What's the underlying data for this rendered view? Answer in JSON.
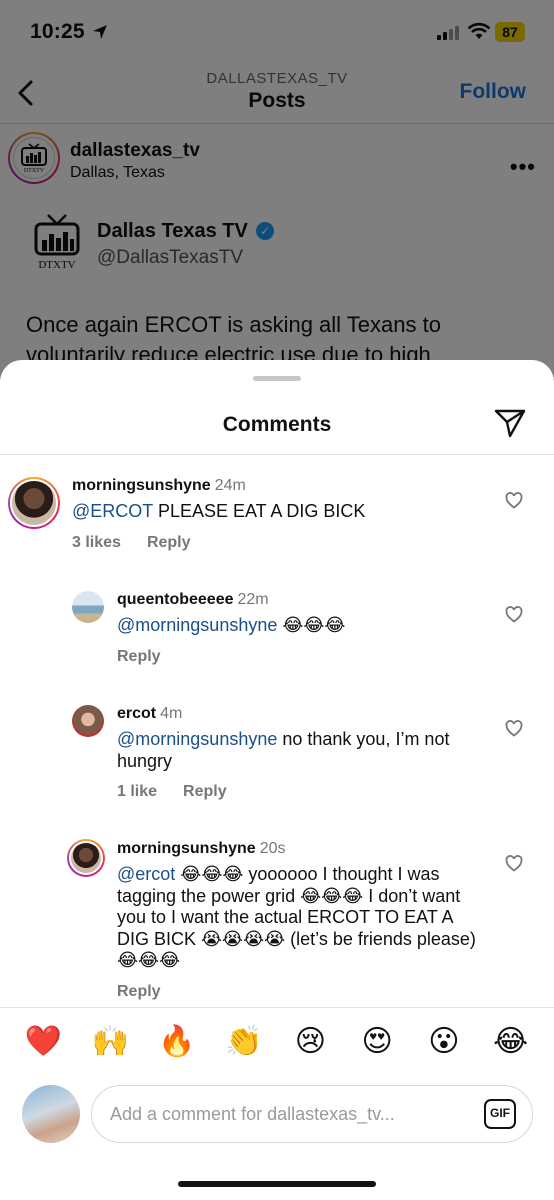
{
  "status_bar": {
    "time": "10:25",
    "battery": "87"
  },
  "nav": {
    "subtitle": "DALLASTEXAS_TV",
    "title": "Posts",
    "follow": "Follow"
  },
  "post": {
    "account": "dallastexas_tv",
    "location": "Dallas, Texas",
    "more": "•••",
    "tweet_name": "Dallas Texas TV",
    "tweet_handle": "@DallasTexasTV",
    "tweet_text": "Once again ERCOT is asking all Texans to voluntarily reduce electric use due to high"
  },
  "sheet": {
    "title": "Comments"
  },
  "comments": [
    {
      "username": "morningsunshyne",
      "ago": "24m",
      "mention": "@ERCOT",
      "text": " PLEASE EAT A DIG BICK",
      "likes": "3 likes",
      "reply": "Reply"
    },
    {
      "username": "queentobeeeee",
      "ago": "22m",
      "mention": "@morningsunshyne",
      "text": " 😂😂😂",
      "likes": "",
      "reply": "Reply"
    },
    {
      "username": "ercot",
      "ago": "4m",
      "mention": "@morningsunshyne",
      "text": " no thank you, I’m not hungry",
      "likes": "1 like",
      "reply": "Reply"
    },
    {
      "username": "morningsunshyne",
      "ago": "20s",
      "mention": "@ercot",
      "text": " 😂😂😂 yoooooo I thought I was tagging the power grid 😂😂😂 I don’t want you to I want the actual ERCOT TO EAT A DIG BICK 😭😭😭😭 (let’s be friends please) 😂😂😂",
      "likes": "",
      "reply": "Reply"
    }
  ],
  "reactions": [
    "❤️",
    "🙌",
    "🔥",
    "👏",
    "😢",
    "😍",
    "😮",
    "😂"
  ],
  "composer": {
    "placeholder": "Add a comment for dallastexas_tv...",
    "gif": "GIF"
  },
  "colors": {
    "link": "#1d72d6",
    "mention": "#1b4f8a",
    "battery": "#f5d000"
  }
}
